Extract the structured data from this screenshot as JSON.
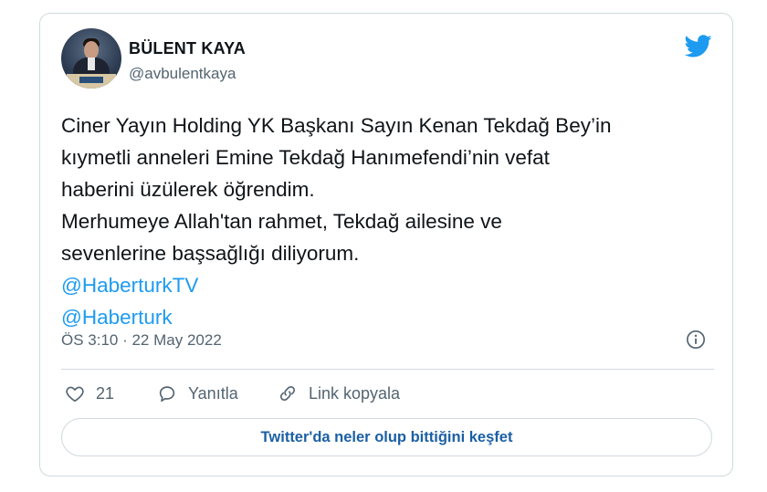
{
  "author": {
    "name": "BÜLENT KAYA",
    "handle": "@avbulentkaya"
  },
  "tweet": {
    "lines": [
      "Ciner Yayın Holding YK Başkanı Sayın Kenan Tekdağ Bey’in",
      "kıymetli anneleri Emine Tekdağ Hanımefendi’nin vefat",
      "haberini üzülerek öğrendim.",
      "Merhumeye Allah'tan rahmet, Tekdağ ailesine ve",
      "sevenlerine başsağlığı diliyorum."
    ],
    "mentions": [
      "@HaberturkTV",
      "@Haberturk"
    ],
    "timestamp": "ÖS 3:10 · 22 May 2022"
  },
  "actions": {
    "like_count": "21",
    "reply_label": "Yanıtla",
    "copy_link_label": "Link kopyala"
  },
  "explore_button": "Twitter'da neler olup bittiğini keşfet",
  "colors": {
    "brand": "#1d9bf0",
    "text": "#0f1419",
    "muted": "#536471",
    "border": "#cfd9de"
  },
  "icons": [
    "twitter-bird-icon",
    "info-icon",
    "heart-icon",
    "reply-icon",
    "link-icon"
  ]
}
